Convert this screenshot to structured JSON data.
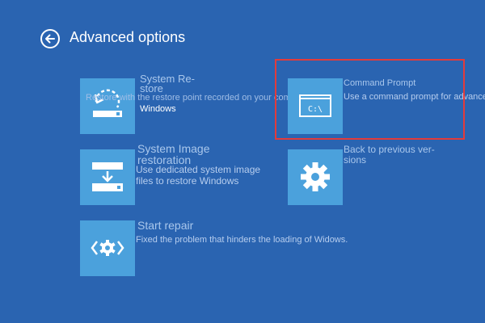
{
  "header": {
    "title": "Advanced options",
    "back_icon": "back-arrow-circle-icon"
  },
  "options": {
    "system_restore": {
      "title_line1": "System Re-",
      "title_line2": "store",
      "description": "Restore with the restore point recorded on your computer",
      "sub": "Windows",
      "icon": "system-restore-icon"
    },
    "command_prompt": {
      "title": "Command Prompt",
      "description": "Use a command prompt for advanced troubleshooting",
      "icon_text": "C:\\",
      "icon": "command-prompt-icon"
    },
    "system_image": {
      "title_line1": "System Image",
      "title_line2": "restoration",
      "desc_line1": "Use dedicated system image",
      "desc_line2": "files to restore Windows",
      "icon": "system-image-icon"
    },
    "previous_version": {
      "title_line1": "Back to previous ver-",
      "title_line2": "sions",
      "icon": "gear-icon"
    },
    "start_repair": {
      "title": "Start repair",
      "description": "Fixed the problem that hinders the loading of Widows.",
      "icon": "repair-icon"
    }
  },
  "colors": {
    "background": "#2a64b1",
    "tile": "#4ba1dc",
    "highlight": "#e23b3b"
  }
}
